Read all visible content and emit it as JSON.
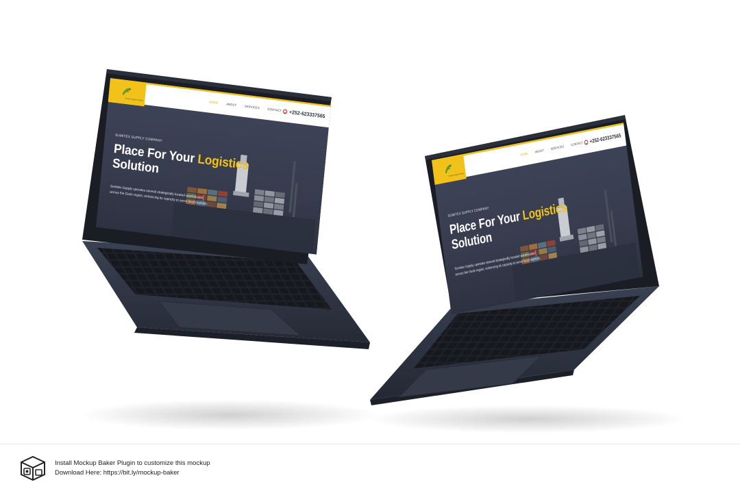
{
  "website": {
    "logo_text": "Sumitex Supply Company",
    "nav": [
      "HOME",
      "ABOUT",
      "SERVICES",
      "CONTACT"
    ],
    "phone": "+252-623337565",
    "eyebrow": "SUMITEX SUPPLY COMPANY",
    "headline_part1": "Place For Your ",
    "headline_highlight": "Logistics",
    "headline_part2": "Solution",
    "description": "Sumitex Supply operates several strategically located warehouses across the Gedo region, enhancing its capacity to serve local markets.",
    "colors": {
      "accent": "#f2c21a",
      "hero_bg": "#3b4152",
      "phone_icon": "#d23b2e"
    }
  },
  "footer": {
    "line1": "Install Mockup Baker Plugin to customize this mockup",
    "line2": "Download Here: https://bit.ly/mockup-baker"
  },
  "colors": {
    "laptop_body": "#2f3646",
    "laptop_bezel": "#1b1e25"
  }
}
